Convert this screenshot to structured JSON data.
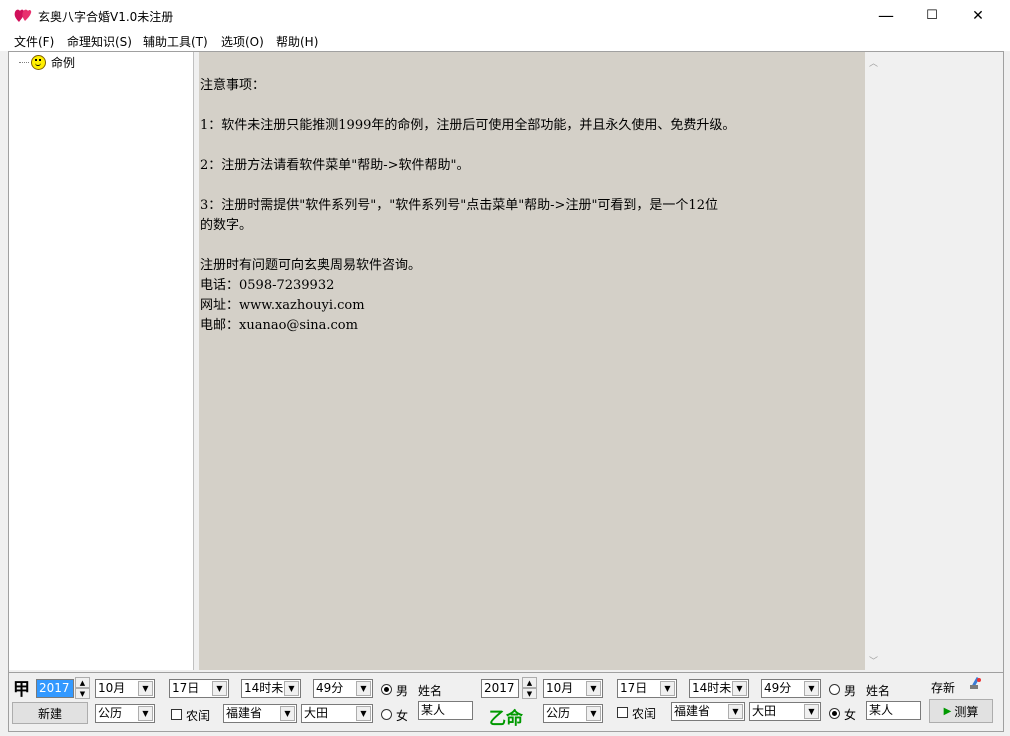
{
  "window": {
    "title": "玄奥八字合婚V1.0未注册",
    "minimize": "—",
    "maximize": "☐",
    "close": "✕"
  },
  "menu": [
    "文件(F)",
    "命理知识(S)",
    "辅助工具(T)",
    "选项(O)",
    "帮助(H)"
  ],
  "tree": {
    "root_label": "命例"
  },
  "notice": {
    "lines": [
      "注意事项：",
      "",
      "1：软件未注册只能推测1999年的命例，注册后可使用全部功能，并且永久使用、免费升级。",
      "",
      "2：注册方法请看软件菜单\"帮助->软件帮助\"。",
      "",
      "3：注册时需提供\"软件系列号\"，\"软件系列号\"点击菜单\"帮助->注册\"可看到，是一个12位",
      "的数字。",
      "",
      "注册时有问题可向玄奥周易软件咨询。",
      "电话：0598-7239932",
      "网址：www.xazhouyi.com",
      "电邮：xuanao@sina.com"
    ]
  },
  "person_a": {
    "label": "甲",
    "year": "2017",
    "month": "10月",
    "day": "17日",
    "hour": "14时未",
    "minute": "49分",
    "gender_male": "男",
    "gender_female": "女",
    "male_selected": true,
    "name_label": "姓名",
    "name_value": "某人",
    "calendar": "公历",
    "leap_label": "农闰",
    "province": "福建省",
    "city": "大田",
    "new_button": "新建"
  },
  "person_b": {
    "label": "乙命",
    "year": "2017",
    "month": "10月",
    "day": "17日",
    "hour": "14时未",
    "minute": "49分",
    "gender_male": "男",
    "gender_female": "女",
    "male_selected": false,
    "name_label": "姓名",
    "name_value": "某人",
    "calendar": "公历",
    "leap_label": "农闰",
    "province": "福建省",
    "city": "大田"
  },
  "actions": {
    "save_label": "存新",
    "calc_button": "测算"
  },
  "colors": {
    "content_bg": "#d4d0c8",
    "label_b": "#009900",
    "calc_arrow": "#009900"
  }
}
